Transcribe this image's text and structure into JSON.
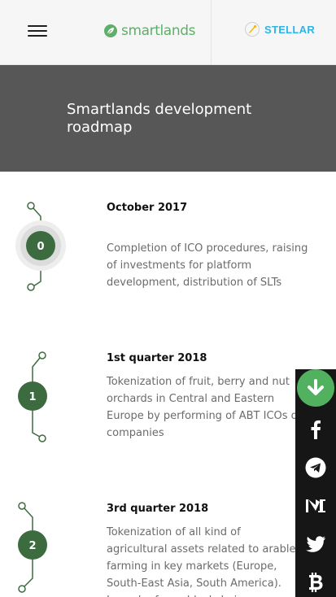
{
  "header": {
    "brand": "smartlands",
    "partner": "STELLAR"
  },
  "banner": {
    "title": "Smartlands development roadmap"
  },
  "roadmap": [
    {
      "step": "0",
      "date": "October 2017",
      "text": "Completion of ICO procedures, raising of investments for platform development, distribution of SLTs"
    },
    {
      "step": "1",
      "date": "1st quarter 2018",
      "text": "Tokenization of fruit, berry and nut orchards in Central and Eastern Europe by performing of ABT ICOs of companies"
    },
    {
      "step": "2",
      "date": "3rd quarter 2018",
      "text": "Tokenization of all kind of agricultural assets related to arable farming in key markets (Europe, South-East Asia, South America). Launch of own blockchain"
    }
  ],
  "social": {
    "icons": [
      "download-icon",
      "facebook-icon",
      "telegram-icon",
      "medium-icon",
      "twitter-icon",
      "bitcoin-icon"
    ]
  },
  "colors": {
    "timeline_green": "#3d6b40",
    "brand_green": "#5fae6a",
    "stellar_blue": "#2ab6e6",
    "banner_bg": "#575757",
    "sidebar_bg": "#161616",
    "download_green": "#52b15f"
  }
}
